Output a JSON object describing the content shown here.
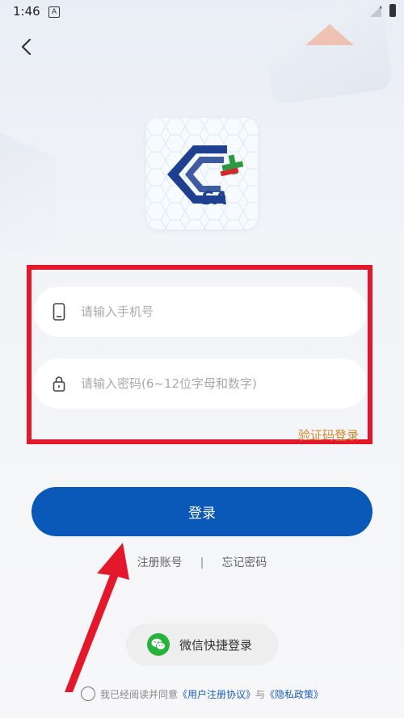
{
  "status_bar": {
    "time": "1:46",
    "a_badge": "A"
  },
  "form": {
    "phone_placeholder": "请输入手机号",
    "password_placeholder": "请输入密码(6~12位字母和数字)",
    "code_login": "验证码登录",
    "login_label": "登录"
  },
  "links": {
    "register": "注册账号",
    "separator": "|",
    "forgot": "忘记密码"
  },
  "wechat": {
    "label": "微信快捷登录"
  },
  "agreement": {
    "prefix": "我已经阅读并同意",
    "user_agreement": "《用户注册协议》",
    "and": "与",
    "privacy_policy": "《隐私政策》"
  },
  "logo": {
    "text": "SA"
  },
  "colors": {
    "primary": "#0a58b8",
    "highlight": "#e3182a",
    "accent_link": "#d38a2b",
    "wechat": "#27b33c"
  }
}
